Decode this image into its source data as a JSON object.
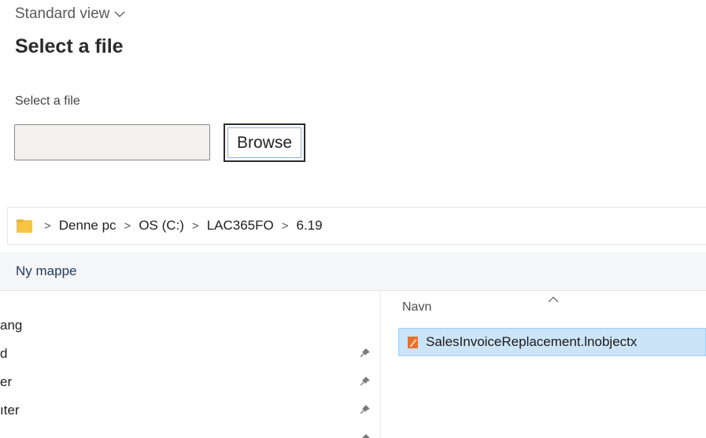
{
  "dialog": {
    "view_label": "Standard view",
    "title": "Select a file",
    "field_label": "Select a file",
    "file_value": "",
    "browse_label": "Browse"
  },
  "explorer": {
    "breadcrumb": [
      "Denne pc",
      "OS (C:)",
      "LAC365FO",
      "6.19"
    ],
    "new_folder_label": "Ny mappe",
    "nav_items": [
      {
        "label": "ang",
        "pinned": false
      },
      {
        "label": "d",
        "pinned": true
      },
      {
        "label": "er",
        "pinned": true
      },
      {
        "label": "ıter",
        "pinned": true
      }
    ],
    "column_header": "Navn",
    "files": [
      {
        "name": "SalesInvoiceReplacement.lnobjectx",
        "selected": true
      }
    ]
  },
  "colors": {
    "selection_bg": "#cce4f7",
    "selection_border": "#99d1ff",
    "folder": "#f5c542",
    "file_icon": "#e8702a"
  }
}
